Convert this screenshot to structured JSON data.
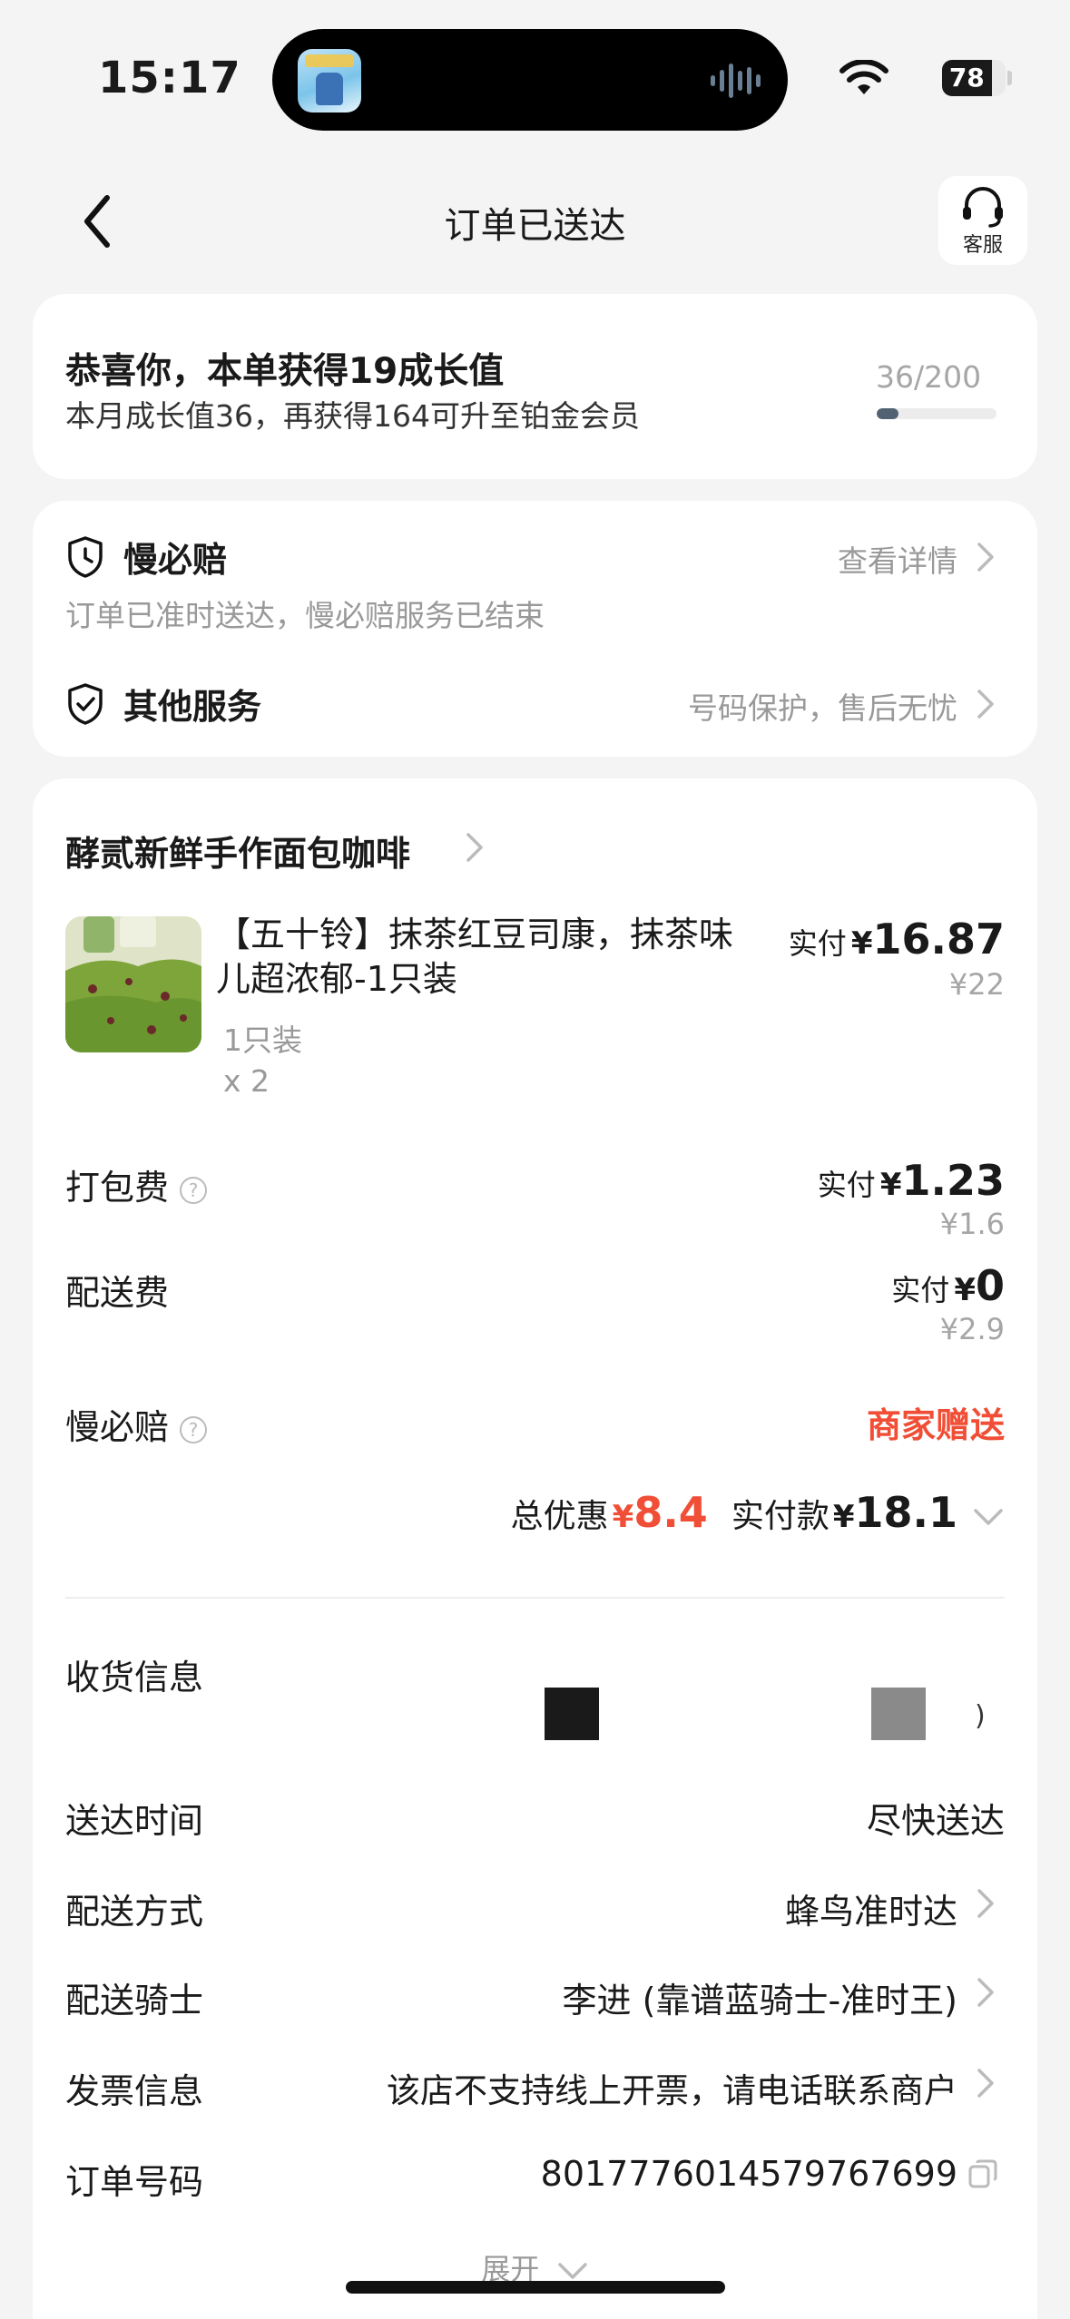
{
  "status_bar": {
    "time": "15:17",
    "battery": "78",
    "battery_level": 0.78
  },
  "nav": {
    "title": "订单已送达",
    "service_label": "客服"
  },
  "growth": {
    "title": "恭喜你，本单获得19成长值",
    "subtitle": "本月成长值36，再获得164可升至铂金会员",
    "progress_text": "36/200",
    "progress": 0.18
  },
  "services": {
    "slow_compensation": {
      "name": "慢必赔",
      "link": "查看详情",
      "desc": "订单已准时送达，慢必赔服务已结束"
    },
    "other": {
      "name": "其他服务",
      "link": "号码保护，售后无忧"
    }
  },
  "order": {
    "shop_name": "酵贰新鲜手作面包咖啡",
    "item": {
      "name": "【五十铃】抹茶红豆司康，抹茶味儿超浓郁-1只装",
      "spec": "1只装",
      "qty": "x 2",
      "paid_label": "实付",
      "currency": "¥",
      "paid": "16.87",
      "original": "¥22"
    },
    "packing": {
      "label": "打包费",
      "paid_label": "实付",
      "currency": "¥",
      "paid": "1.23",
      "original": "¥1.6"
    },
    "delivery": {
      "label": "配送费",
      "paid_label": "实付",
      "currency": "¥",
      "paid": "0",
      "original": "¥2.9"
    },
    "slow_comp": {
      "label": "慢必赔",
      "value": "商家赠送"
    },
    "totals": {
      "discount_label": "总优惠",
      "discount_currency": "¥",
      "discount": "8.4",
      "paid_label": "实付款",
      "paid_currency": "¥",
      "paid": "18.1"
    }
  },
  "info": {
    "receiver": {
      "label": "收货信息",
      "tail": ")"
    },
    "delivery_time": {
      "label": "送达时间",
      "value": "尽快送达"
    },
    "delivery_method": {
      "label": "配送方式",
      "value": "蜂鸟准时达"
    },
    "rider": {
      "label": "配送骑士",
      "value": "李进 (靠谱蓝骑士-准时王)"
    },
    "invoice": {
      "label": "发票信息",
      "value": "该店不支持线上开票，请电话联系商户"
    },
    "order_no": {
      "label": "订单号码",
      "value": "8017776014579767699"
    }
  },
  "expand_label": "展开",
  "icons": {
    "back": "chevron-left-icon",
    "service": "headset-icon",
    "clock_shield": "clock-shield-icon",
    "check_shield": "check-shield-icon",
    "copy": "copy-icon"
  },
  "colors": {
    "accent_red": "#f04e36",
    "background": "#f4f4f4",
    "muted": "#999999"
  }
}
